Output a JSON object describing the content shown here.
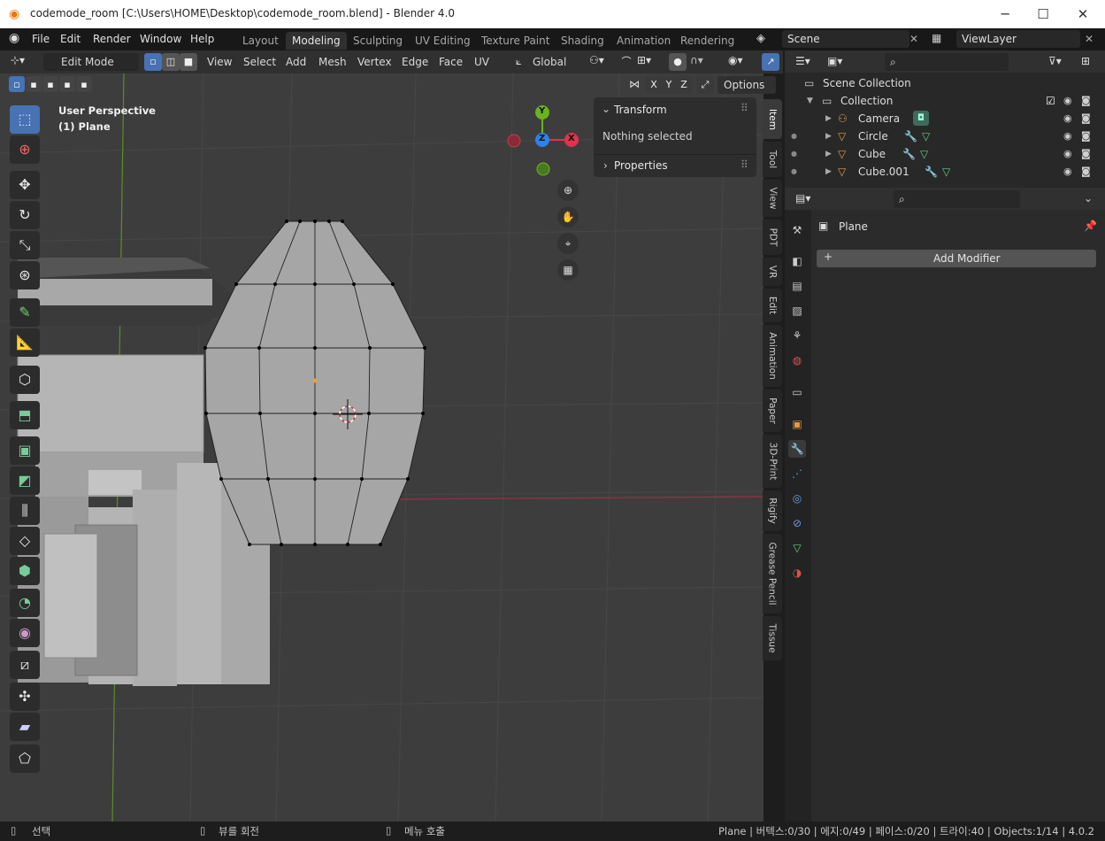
{
  "window": {
    "title": "codemode_room [C:\\Users\\HOME\\Desktop\\codemode_room.blend] - Blender 4.0",
    "minimize": "─",
    "maximize": "☐",
    "close": "✕"
  },
  "menu": {
    "file": "File",
    "edit": "Edit",
    "render": "Render",
    "window": "Window",
    "help": "Help"
  },
  "workspaces": [
    "Layout",
    "Modeling",
    "Sculpting",
    "UV Editing",
    "Texture Paint",
    "Shading",
    "Animation",
    "Rendering"
  ],
  "scene": "Scene",
  "view_layer": "ViewLayer",
  "header": {
    "mode": "Edit Mode",
    "view": "View",
    "select": "Select",
    "add": "Add",
    "mesh": "Mesh",
    "vertex": "Vertex",
    "edge": "Edge",
    "face": "Face",
    "uv": "UV",
    "orientation": "Global",
    "options": "Options",
    "x": "X",
    "y": "Y",
    "z": "Z"
  },
  "viewport": {
    "perspective": "User Perspective",
    "object": "(1) Plane"
  },
  "gizmo": {
    "y": "Y",
    "z": "Z",
    "x": "X"
  },
  "npanel": {
    "transform": "Transform",
    "nothing": "Nothing selected",
    "properties": "Properties"
  },
  "npanel_tabs": [
    "Item",
    "Tool",
    "View",
    "PDT",
    "VR",
    "Edit",
    "Animation",
    "Paper",
    "3D-Print",
    "Rigify",
    "Grease Pencil",
    "Tissue"
  ],
  "outliner": {
    "scene_collection": "Scene Collection",
    "collection": "Collection",
    "items": [
      "Camera",
      "Circle",
      "Cube",
      "Cube.001"
    ]
  },
  "properties": {
    "object": "Plane",
    "add_modifier": "Add Modifier"
  },
  "status": {
    "select": "선택",
    "rotate": "뷰를 회전",
    "menu": "메뉴 호출",
    "stats": "Plane | 버텍스:0/30 | 에지:0/49 | 페이스:0/20 | 트라이:40 | Objects:1/14 | 4.0.2"
  },
  "colors": {
    "accent": "#4772b3",
    "x_axis": "#e0334c",
    "y_axis": "#6ab31d",
    "z_axis": "#2f82e8"
  }
}
